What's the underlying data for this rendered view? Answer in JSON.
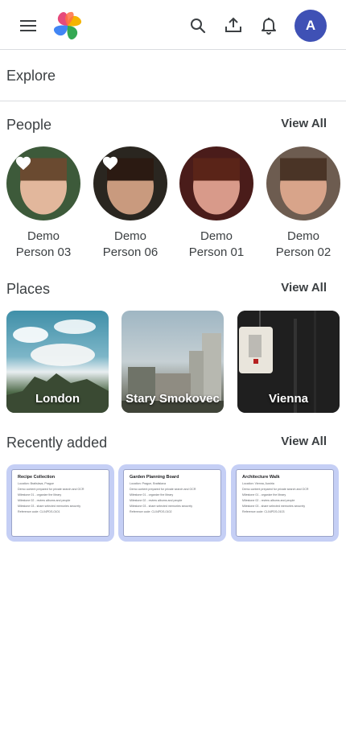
{
  "header": {
    "menu_icon": "menu-icon",
    "logo_icon": "pinwheel-logo",
    "search_icon": "search-icon",
    "upload_icon": "upload-icon",
    "bell_icon": "bell-icon",
    "avatar_letter": "A",
    "avatar_color": "#3f51b5"
  },
  "explore": {
    "title": "Explore"
  },
  "people": {
    "title": "People",
    "view_all": "View All",
    "items": [
      {
        "name_line1": "Demo",
        "name_line2": "Person 03",
        "favorite": true
      },
      {
        "name_line1": "Demo",
        "name_line2": "Person 06",
        "favorite": true
      },
      {
        "name_line1": "Demo",
        "name_line2": "Person 01",
        "favorite": false
      },
      {
        "name_line1": "Demo",
        "name_line2": "Person 02",
        "favorite": false
      }
    ]
  },
  "places": {
    "title": "Places",
    "view_all": "View All",
    "items": [
      {
        "label": "London"
      },
      {
        "label": "Stary Smokovec"
      },
      {
        "label": "Vienna"
      }
    ]
  },
  "recent": {
    "title": "Recently added",
    "view_all": "View All",
    "items": [
      {
        "doc_title": "Recipe Collection",
        "lines": [
          "Location: Bratislava, Prague",
          "Demo content prepared for private search and OCR",
          "Milestone 01 - organize the library",
          "Milestone 02 - review albums and people",
          "Milestone 03 - share selected memories securely",
          "Reference code: CL04PDS-0101"
        ]
      },
      {
        "doc_title": "Garden Planning Board",
        "lines": [
          "Location: Prague, Bratislava",
          "Demo content prepared for private search and OCR",
          "Milestone 01 - organize the library",
          "Milestone 02 - review albums and people",
          "Milestone 03 - share selected memories securely",
          "Reference code: CL04PDS-0102"
        ]
      },
      {
        "doc_title": "Architecture Walk",
        "lines": [
          "Location: Vienna, Austria",
          "Demo content prepared for private search and OCR",
          "Milestone 01 - organize the library",
          "Milestone 02 - review albums and people",
          "Milestone 03 - share selected memories securely",
          "Reference code: CL04PDS-0103"
        ]
      }
    ]
  }
}
